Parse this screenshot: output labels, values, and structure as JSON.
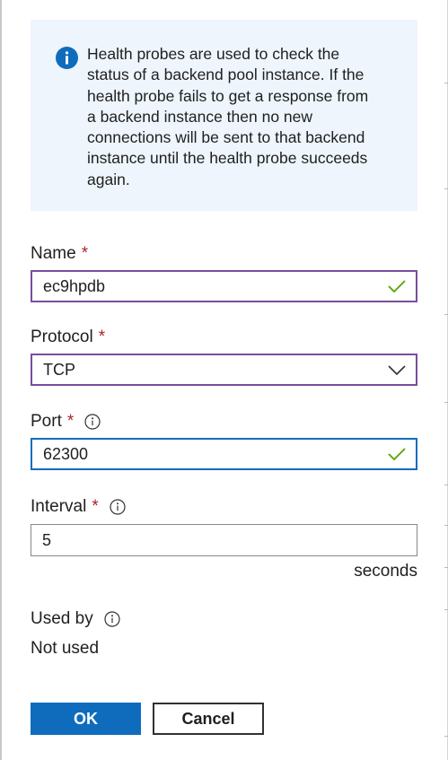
{
  "info": {
    "icon": "info-icon",
    "text": "Health probes are used to check the\nstatus of a backend pool instance. If the\nhealth probe fails to get a response from\na backend instance then no new\nconnections will be sent to that backend\ninstance until the health probe succeeds\nagain."
  },
  "name_field": {
    "label": "Name",
    "required": "*",
    "value": "ec9hpdb"
  },
  "protocol_field": {
    "label": "Protocol",
    "required": "*",
    "value": "TCP"
  },
  "port_field": {
    "label": "Port",
    "required": "*",
    "value": "62300"
  },
  "interval_field": {
    "label": "Interval",
    "required": "*",
    "value": "5",
    "unit": "seconds"
  },
  "used_by": {
    "label": "Used by",
    "value": "Not used"
  },
  "buttons": {
    "ok": "OK",
    "cancel": "Cancel"
  },
  "colors": {
    "info_bg": "#eef5fd",
    "info_icon": "#0f6cbd",
    "required": "#a4262c",
    "valid_check": "#57a300",
    "focus_purple": "#7a4c9e",
    "focus_blue": "#0f6cbd",
    "primary_button": "#0f6cbd"
  }
}
